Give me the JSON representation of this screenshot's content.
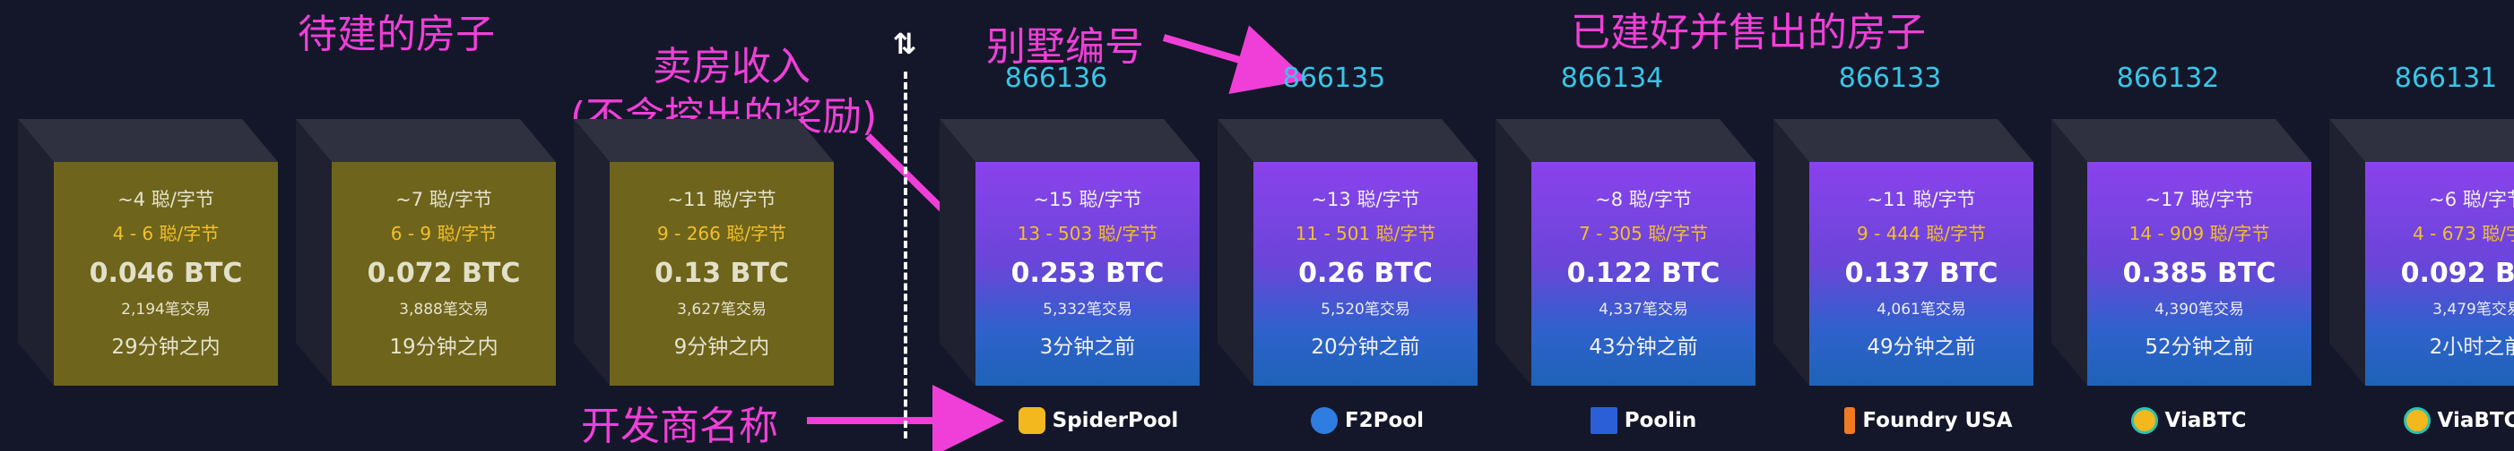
{
  "pending_blocks": [
    {
      "median_fee": "~4 聪/字节",
      "fee_range": "4 - 6 聪/字节",
      "reward": "0.046 BTC",
      "tx_count": "2,194笔交易",
      "time": "29分钟之内"
    },
    {
      "median_fee": "~7 聪/字节",
      "fee_range": "6 - 9 聪/字节",
      "reward": "0.072 BTC",
      "tx_count": "3,888笔交易",
      "time": "19分钟之内"
    },
    {
      "median_fee": "~11 聪/字节",
      "fee_range": "9 - 266 聪/字节",
      "reward": "0.13 BTC",
      "tx_count": "3,627笔交易",
      "time": "9分钟之内"
    }
  ],
  "mined_blocks": [
    {
      "height": "866136",
      "median_fee": "~15 聪/字节",
      "fee_range": "13 - 503 聪/字节",
      "reward": "0.253 BTC",
      "tx_count": "5,332笔交易",
      "time": "3分钟之前",
      "pool": "SpiderPool",
      "pool_icon": "spiderpool-icon",
      "pool_color": "#f2b81e"
    },
    {
      "height": "866135",
      "median_fee": "~13 聪/字节",
      "fee_range": "11 - 501 聪/字节",
      "reward": "0.26 BTC",
      "tx_count": "5,520笔交易",
      "time": "20分钟之前",
      "pool": "F2Pool",
      "pool_icon": "f2pool-icon",
      "pool_color": "#2f7de0"
    },
    {
      "height": "866134",
      "median_fee": "~8 聪/字节",
      "fee_range": "7 - 305 聪/字节",
      "reward": "0.122 BTC",
      "tx_count": "4,337笔交易",
      "time": "43分钟之前",
      "pool": "Poolin",
      "pool_icon": "poolin-icon",
      "pool_color": "#2b5fd8"
    },
    {
      "height": "866133",
      "median_fee": "~11 聪/字节",
      "fee_range": "9 - 444 聪/字节",
      "reward": "0.137 BTC",
      "tx_count": "4,061笔交易",
      "time": "49分钟之前",
      "pool": "Foundry USA",
      "pool_icon": "foundry-icon",
      "pool_color": "#f07a22"
    },
    {
      "height": "866132",
      "median_fee": "~17 聪/字节",
      "fee_range": "14 - 909 聪/字节",
      "reward": "0.385 BTC",
      "tx_count": "4,390笔交易",
      "time": "52分钟之前",
      "pool": "ViaBTC",
      "pool_icon": "viabtc-icon",
      "pool_color": "#2ec2b0"
    },
    {
      "height": "866131",
      "median_fee": "~6 聪/字节",
      "fee_range": "4 - 673 聪/字节",
      "reward": "0.092 BTC",
      "tx_count": "3,479笔交易",
      "time": "2小时之前",
      "pool": "ViaBTC",
      "pool_icon": "viabtc-icon",
      "pool_color": "#2ec2b0"
    }
  ],
  "annotations": {
    "pending_title": "待建的房子",
    "mined_title": "已建好并售出的房子",
    "block_height": "别墅编号",
    "revenue_line1": "卖房收入",
    "revenue_line2": "(不含挖出的奖励)",
    "developer": "开发商名称"
  },
  "swap_icon": "swap-arrows-icon",
  "colors": {
    "background": "#14172a",
    "annotation": "#f03fd8",
    "height": "#38c6e6",
    "fee_range": "#f2c02b",
    "pending_face": "#6e641b"
  }
}
